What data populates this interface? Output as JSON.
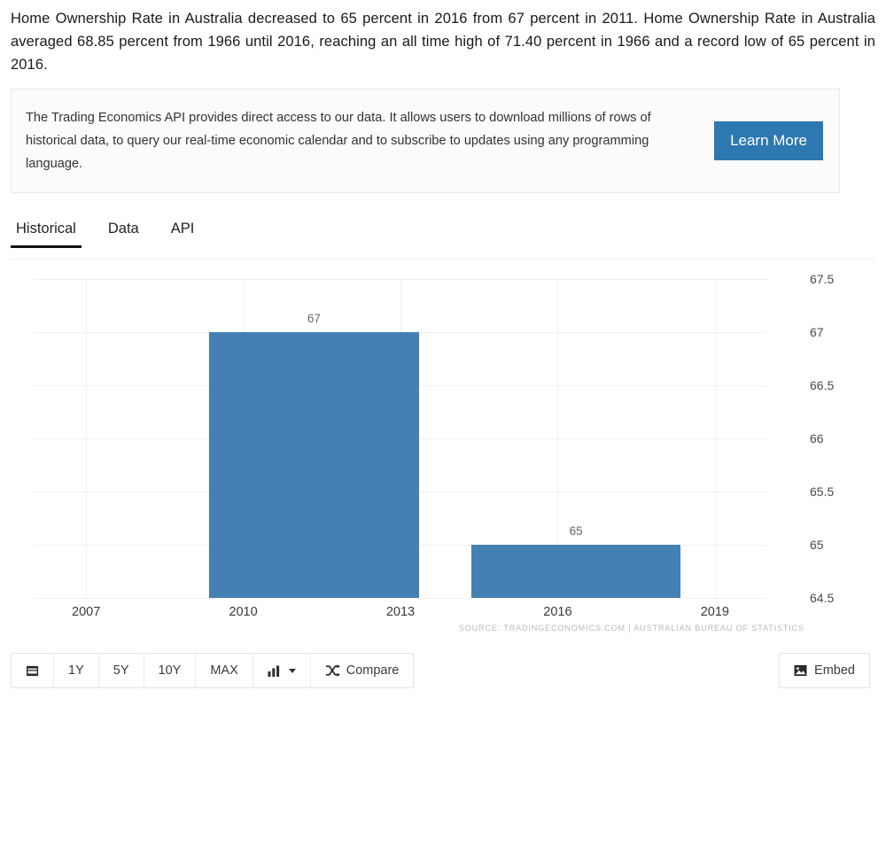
{
  "intro": {
    "paragraph": "Home Ownership Rate in Australia decreased to 65 percent in 2016 from 67 percent in 2011. Home Ownership Rate in Australia averaged 68.85 percent from 1966 until 2016, reaching an all time high of 71.40 percent in 1966 and a record low of 65 percent in 2016."
  },
  "promo": {
    "text": "The Trading Economics API provides direct access to our data. It allows users to download millions of rows of historical data, to query our real-time economic calendar and to subscribe to updates using any programming language.",
    "button_label": "Learn More",
    "button_color": "#2e78b2"
  },
  "tabs": [
    {
      "label": "Historical",
      "active": true
    },
    {
      "label": "Data",
      "active": false
    },
    {
      "label": "API",
      "active": false
    }
  ],
  "toolbar": {
    "range_buttons": [
      "1Y",
      "5Y",
      "10Y",
      "MAX"
    ],
    "calendar_icon": "calendar-icon",
    "chart_type_icon": "bar-chart-icon",
    "compare_icon": "shuffle-icon",
    "compare_label": "Compare",
    "embed_icon": "image-icon",
    "embed_label": "Embed"
  },
  "chart_data": {
    "type": "bar",
    "title": "",
    "xlabel": "",
    "ylabel": "",
    "categories": [
      2011,
      2016
    ],
    "values": [
      67,
      65
    ],
    "bar_labels": [
      "67",
      "65"
    ],
    "bar_color": "#4480b3",
    "ylim": [
      64.5,
      67.5
    ],
    "yticks": [
      "67.5",
      "67",
      "66.5",
      "66",
      "65.5",
      "65",
      "64.5"
    ],
    "ytick_values": [
      67.5,
      67,
      66.5,
      66,
      65.5,
      65,
      64.5
    ],
    "xticks": [
      "2007",
      "2010",
      "2013",
      "2016",
      "2019"
    ],
    "xtick_values": [
      2007,
      2010,
      2013,
      2016,
      2019
    ],
    "xlim": [
      2006,
      2020
    ],
    "grid": true,
    "legend": false,
    "source": "SOURCE: TRADINGECONOMICS.COM  |  AUSTRALIAN BUREAU OF STATISTICS"
  }
}
